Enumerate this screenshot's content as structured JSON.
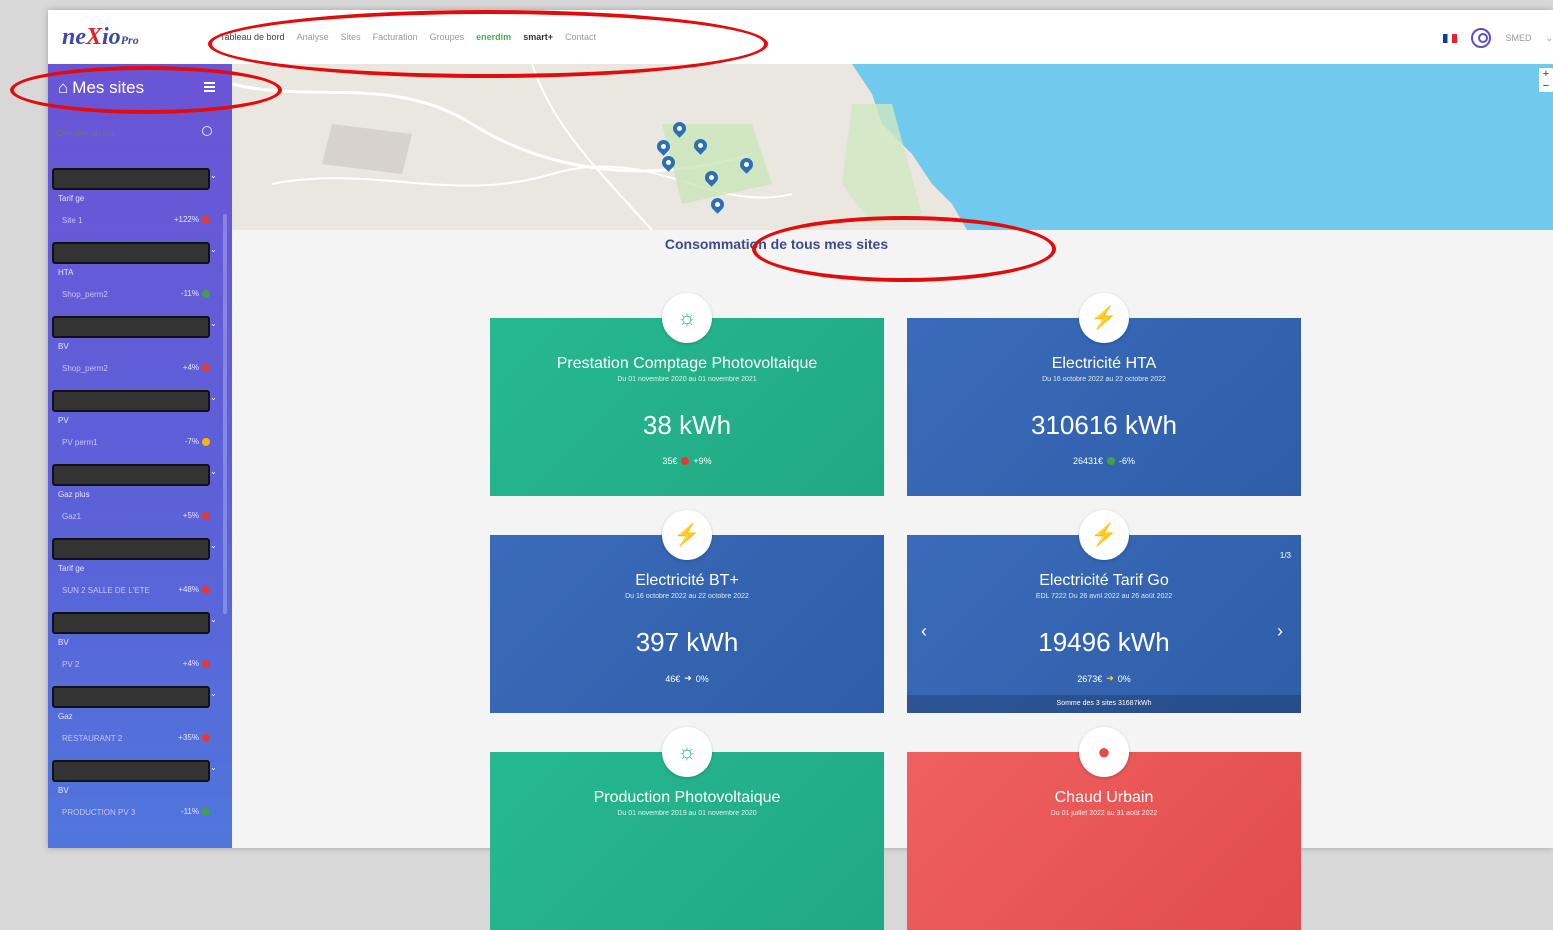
{
  "app": {
    "logo_main": "ne",
    "logo_x": "X",
    "logo_rest": "io",
    "logo_sub": "Pro"
  },
  "nav": {
    "items": [
      "Tableau de bord",
      "Analyse",
      "Sites",
      "Facturation",
      "Groupes"
    ],
    "brand1": "enerdim",
    "brand2": "smart+",
    "contact": "Contact"
  },
  "header_right": {
    "user_label": "SMED"
  },
  "sidebar": {
    "title": "Mes sites",
    "search_placeholder": "Chercher un site",
    "sites": [
      {
        "type": "Tarif ge",
        "meter": "Site 1",
        "pct": "+122%",
        "trend": "up"
      },
      {
        "type": "HTA",
        "meter": "Shop_perm2",
        "pct": "-11%",
        "trend": "down"
      },
      {
        "type": "BV",
        "meter": "Shop_perm2",
        "pct": "+4%",
        "trend": "up"
      },
      {
        "type": "PV",
        "meter": "PV perm1",
        "pct": "-7%",
        "trend": "flat"
      },
      {
        "type": "Gaz plus",
        "meter": "Gaz1",
        "pct": "+5%",
        "trend": "up"
      },
      {
        "type": "Tarif ge",
        "meter": "SUN 2 SALLE DE L'ETE",
        "pct": "+48%",
        "trend": "up"
      },
      {
        "type": "BV",
        "meter": "PV 2",
        "pct": "+4%",
        "trend": "up"
      },
      {
        "type": "Gaz",
        "meter": "RESTAURANT 2",
        "pct": "+35%",
        "trend": "up"
      },
      {
        "type": "BV",
        "meter": "PRODUCTION PV 3",
        "pct": "-11%",
        "trend": "down"
      }
    ]
  },
  "map": {
    "zoom_in": "+",
    "zoom_out": "−"
  },
  "main": {
    "section_title": "Consommation de tous mes sites",
    "cards": [
      {
        "title": "Prestation Comptage Photovoltaique",
        "period": "Du 01 novembre 2020 au 01 novembre 2021",
        "value": "38 kWh",
        "cost": "35€",
        "delta": "+9%",
        "trend": "up",
        "icon": "sun-icon",
        "color": "green"
      },
      {
        "title": "Electricité HTA",
        "period": "Du 16 octobre 2022 au 22 octobre 2022",
        "value": "310616 kWh",
        "cost": "26431€",
        "delta": "-6%",
        "trend": "down",
        "icon": "bolt-icon",
        "color": "blue"
      },
      {
        "title": "Electricité BT+",
        "period": "Du 16 octobre 2022 au 22 octobre 2022",
        "value": "397 kWh",
        "cost": "46€",
        "delta": "0%",
        "trend": "flat",
        "icon": "bolt-icon",
        "color": "blue"
      },
      {
        "title": "Electricité Tarif Go",
        "period": "EDL 7222 Du 26 avril 2022 au 26 août 2022",
        "value": "19496 kWh",
        "cost": "2673€",
        "delta": "0%",
        "trend": "flat",
        "icon": "bolt-icon",
        "color": "blue",
        "pager": "1/3",
        "sum": "Somme des 3 sites 31687kWh"
      },
      {
        "title": "Production Photovoltaique",
        "period": "Du 01 novembre 2019 au 01 novembre 2020",
        "icon": "sun-icon",
        "color": "green"
      },
      {
        "title": "Chaud Urbain",
        "period": "Du 01 juillet 2022 au 31 août 2022",
        "icon": "drop-icon",
        "color": "red"
      }
    ]
  },
  "colors": {
    "sidebar": "#6a55d6",
    "green": "#26b990",
    "blue": "#3a6bba",
    "red": "#f06060",
    "annotation": "#e40b0b"
  }
}
